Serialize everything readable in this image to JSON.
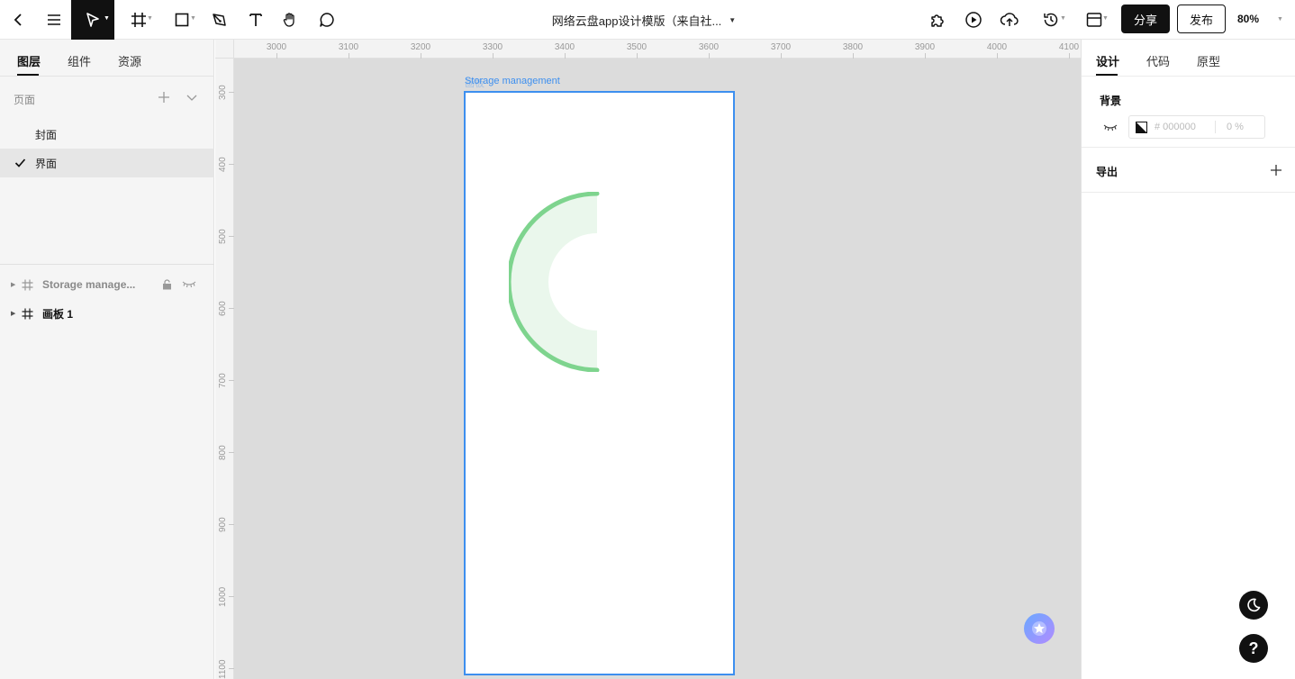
{
  "toolbar": {
    "document_title": "网络云盘app设计模版（来自社...",
    "share_label": "分享",
    "publish_label": "发布",
    "zoom": "80%",
    "icons": [
      "back-icon",
      "menu-icon",
      "move-tool-icon",
      "frame-tool-icon",
      "rectangle-tool-icon",
      "pen-tool-icon",
      "text-tool-icon",
      "hand-tool-icon",
      "comment-tool-icon",
      "plugin-icon",
      "play-icon",
      "upload-icon",
      "history-icon",
      "layout-icon"
    ]
  },
  "left_panel": {
    "tabs": [
      {
        "label": "图层"
      },
      {
        "label": "组件"
      },
      {
        "label": "资源"
      }
    ],
    "pages_title": "页面",
    "pages": [
      {
        "label": "封面"
      },
      {
        "label": "界面"
      }
    ],
    "layers": [
      {
        "label": "Storage manage..."
      },
      {
        "label": "画板 1"
      }
    ]
  },
  "canvas": {
    "artboard_label": "Storage management",
    "artboard_label_ghost": "画板",
    "ruler_top": [
      "3000",
      "3100",
      "3200",
      "3300",
      "3400",
      "3500",
      "3600",
      "3700",
      "3800",
      "3900",
      "4000",
      "4100"
    ],
    "ruler_left": [
      "300",
      "400",
      "500",
      "600",
      "700",
      "800",
      "900",
      "1000",
      "1100"
    ],
    "colors": {
      "selection": "#3d8fef",
      "arc": "#7ed48e",
      "arc_fill": "#eaf7ec"
    }
  },
  "right_panel": {
    "tabs": [
      {
        "label": "设计"
      },
      {
        "label": "代码"
      },
      {
        "label": "原型"
      }
    ],
    "background_title": "背景",
    "bg_color_hex": "# 000000",
    "bg_opacity": "0 %",
    "export_title": "导出"
  },
  "floating": {
    "dark_mode_icon": "moon-icon",
    "help_label": "?"
  }
}
